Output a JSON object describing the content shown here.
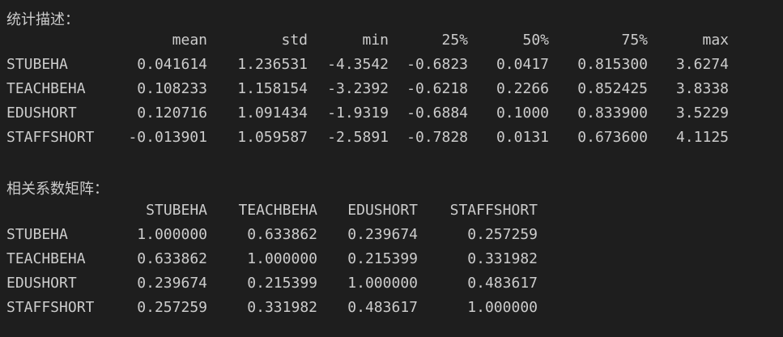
{
  "stats": {
    "title": "统计描述：",
    "columns": [
      "mean",
      "std",
      "min",
      "25%",
      "50%",
      "75%",
      "max"
    ],
    "rows": [
      {
        "label": "STUBEHA",
        "values": [
          "0.041614",
          "1.236531",
          "-4.3542",
          "-0.6823",
          "0.0417",
          "0.815300",
          "3.6274"
        ]
      },
      {
        "label": "TEACHBEHA",
        "values": [
          "0.108233",
          "1.158154",
          "-3.2392",
          "-0.6218",
          "0.2266",
          "0.852425",
          "3.8338"
        ]
      },
      {
        "label": "EDUSHORT",
        "values": [
          "0.120716",
          "1.091434",
          "-1.9319",
          "-0.6884",
          "0.1000",
          "0.833900",
          "3.5229"
        ]
      },
      {
        "label": "STAFFSHORT",
        "values": [
          "-0.013901",
          "1.059587",
          "-2.5891",
          "-0.7828",
          "0.0131",
          "0.673600",
          "4.1125"
        ]
      }
    ]
  },
  "corr": {
    "title": "相关系数矩阵：",
    "columns": [
      "STUBEHA",
      "TEACHBEHA",
      "EDUSHORT",
      "STAFFSHORT"
    ],
    "rows": [
      {
        "label": "STUBEHA",
        "values": [
          "1.000000",
          "0.633862",
          "0.239674",
          "0.257259"
        ]
      },
      {
        "label": "TEACHBEHA",
        "values": [
          "0.633862",
          "1.000000",
          "0.215399",
          "0.331982"
        ]
      },
      {
        "label": "EDUSHORT",
        "values": [
          "0.239674",
          "0.215399",
          "1.000000",
          "0.483617"
        ]
      },
      {
        "label": "STAFFSHORT",
        "values": [
          "0.257259",
          "0.331982",
          "0.483617",
          "1.000000"
        ]
      }
    ]
  }
}
